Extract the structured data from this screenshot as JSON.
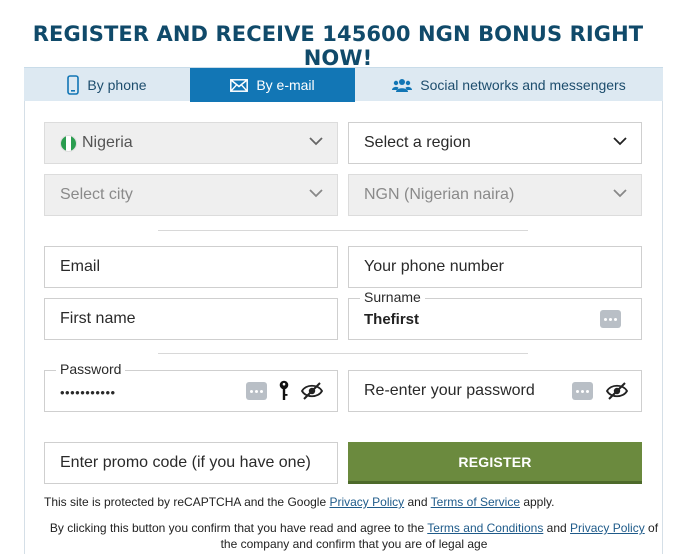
{
  "headline": "REGISTER AND RECEIVE 145600 NGN BONUS RIGHT NOW!",
  "tabs": [
    {
      "label": "By phone",
      "icon": "phone-icon",
      "active": false
    },
    {
      "label": "By e-mail",
      "icon": "envelope-icon",
      "active": true
    },
    {
      "label": "Social networks and messengers",
      "icon": "people-icon",
      "active": false
    }
  ],
  "form": {
    "country": {
      "value": "Nigeria",
      "flag_icon": "nigeria-flag-icon"
    },
    "region": {
      "placeholder": "Select a region"
    },
    "city": {
      "placeholder": "Select city"
    },
    "currency": {
      "value": "NGN (Nigerian naira)"
    },
    "email": {
      "placeholder": "Email"
    },
    "phone": {
      "placeholder": "Your phone number"
    },
    "first_name": {
      "placeholder": "First name"
    },
    "surname": {
      "label": "Surname",
      "value": "Thefirst"
    },
    "password": {
      "label": "Password",
      "value": "•••••••••••"
    },
    "repeat_password": {
      "placeholder": "Re-enter your password"
    },
    "promo": {
      "placeholder": "Enter promo code (if you have one)"
    },
    "register_label": "REGISTER"
  },
  "recaptcha": {
    "prefix": "This site is protected by reCAPTCHA and the Google ",
    "privacy_link": "Privacy Policy",
    "and": " and ",
    "terms_link": "Terms of Service",
    "suffix": " apply."
  },
  "consent": {
    "prefix": "By clicking this button you confirm that you have read and agree to the ",
    "terms_link": "Terms and Conditions",
    "and": " and ",
    "privacy_link": "Privacy Policy",
    "suffix_line1": " of",
    "line2": "the company and confirm that you are of legal age"
  },
  "colors": {
    "headline": "#104a6a",
    "tab_bar": "#dde9f2",
    "active_tab": "#1276b5",
    "register_button": "#6b8a3e",
    "link": "#1f5b8a"
  }
}
